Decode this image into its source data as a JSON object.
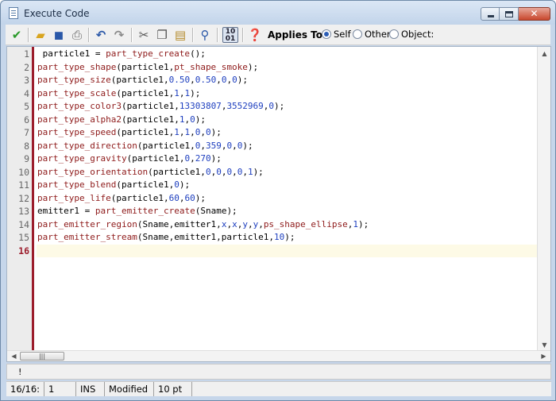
{
  "window": {
    "title": "Execute Code"
  },
  "toolbar": {
    "applies_label": "Applies To:",
    "options": [
      {
        "label": "Self",
        "checked": true
      },
      {
        "label": "Other",
        "checked": false
      },
      {
        "label": "Object:",
        "checked": false
      }
    ],
    "icons": [
      "check-icon",
      "open-folder-icon",
      "save-icon",
      "print-icon",
      "undo-icon",
      "redo-icon",
      "cut-icon",
      "copy-icon",
      "paste-icon",
      "search-icon",
      "toggle-icon",
      "help-icon"
    ]
  },
  "editor": {
    "current_line": 16,
    "lines": [
      [
        [
          "t",
          " particle1 = "
        ],
        [
          "fn",
          "part_type_create"
        ],
        [
          "t",
          "();"
        ]
      ],
      [
        [
          "fn",
          "part_type_shape"
        ],
        [
          "t",
          "(particle1,"
        ],
        [
          "fn",
          "pt_shape_smoke"
        ],
        [
          "t",
          ");"
        ]
      ],
      [
        [
          "fn",
          "part_type_size"
        ],
        [
          "t",
          "(particle1,"
        ],
        [
          "num",
          "0.50"
        ],
        [
          "t",
          ","
        ],
        [
          "num",
          "0.50"
        ],
        [
          "t",
          ","
        ],
        [
          "num",
          "0"
        ],
        [
          "t",
          ","
        ],
        [
          "num",
          "0"
        ],
        [
          "t",
          ");"
        ]
      ],
      [
        [
          "fn",
          "part_type_scale"
        ],
        [
          "t",
          "(particle1,"
        ],
        [
          "num",
          "1"
        ],
        [
          "t",
          ","
        ],
        [
          "num",
          "1"
        ],
        [
          "t",
          ");"
        ]
      ],
      [
        [
          "fn",
          "part_type_color3"
        ],
        [
          "t",
          "(particle1,"
        ],
        [
          "num",
          "13303807"
        ],
        [
          "t",
          ","
        ],
        [
          "num",
          "3552969"
        ],
        [
          "t",
          ","
        ],
        [
          "num",
          "0"
        ],
        [
          "t",
          ");"
        ]
      ],
      [
        [
          "fn",
          "part_type_alpha2"
        ],
        [
          "t",
          "(particle1,"
        ],
        [
          "num",
          "1"
        ],
        [
          "t",
          ","
        ],
        [
          "num",
          "0"
        ],
        [
          "t",
          ");"
        ]
      ],
      [
        [
          "fn",
          "part_type_speed"
        ],
        [
          "t",
          "(particle1,"
        ],
        [
          "num",
          "1"
        ],
        [
          "t",
          ","
        ],
        [
          "num",
          "1"
        ],
        [
          "t",
          ","
        ],
        [
          "num",
          "0"
        ],
        [
          "t",
          ","
        ],
        [
          "num",
          "0"
        ],
        [
          "t",
          ");"
        ]
      ],
      [
        [
          "fn",
          "part_type_direction"
        ],
        [
          "t",
          "(particle1,"
        ],
        [
          "num",
          "0"
        ],
        [
          "t",
          ","
        ],
        [
          "num",
          "359"
        ],
        [
          "t",
          ","
        ],
        [
          "num",
          "0"
        ],
        [
          "t",
          ","
        ],
        [
          "num",
          "0"
        ],
        [
          "t",
          ");"
        ]
      ],
      [
        [
          "fn",
          "part_type_gravity"
        ],
        [
          "t",
          "(particle1,"
        ],
        [
          "num",
          "0"
        ],
        [
          "t",
          ","
        ],
        [
          "num",
          "270"
        ],
        [
          "t",
          ");"
        ]
      ],
      [
        [
          "fn",
          "part_type_orientation"
        ],
        [
          "t",
          "(particle1,"
        ],
        [
          "num",
          "0"
        ],
        [
          "t",
          ","
        ],
        [
          "num",
          "0"
        ],
        [
          "t",
          ","
        ],
        [
          "num",
          "0"
        ],
        [
          "t",
          ","
        ],
        [
          "num",
          "0"
        ],
        [
          "t",
          ","
        ],
        [
          "num",
          "1"
        ],
        [
          "t",
          ");"
        ]
      ],
      [
        [
          "fn",
          "part_type_blend"
        ],
        [
          "t",
          "(particle1,"
        ],
        [
          "num",
          "0"
        ],
        [
          "t",
          ");"
        ]
      ],
      [
        [
          "fn",
          "part_type_life"
        ],
        [
          "t",
          "(particle1,"
        ],
        [
          "num",
          "60"
        ],
        [
          "t",
          ","
        ],
        [
          "num",
          "60"
        ],
        [
          "t",
          ");"
        ]
      ],
      [
        [
          "t",
          "emitter1 = "
        ],
        [
          "fn",
          "part_emitter_create"
        ],
        [
          "t",
          "(Sname);"
        ]
      ],
      [
        [
          "fn",
          "part_emitter_region"
        ],
        [
          "t",
          "(Sname,emitter1,"
        ],
        [
          "res",
          "x"
        ],
        [
          "t",
          ","
        ],
        [
          "res",
          "x"
        ],
        [
          "t",
          ","
        ],
        [
          "res",
          "y"
        ],
        [
          "t",
          ","
        ],
        [
          "res",
          "y"
        ],
        [
          "t",
          ","
        ],
        [
          "fn",
          "ps_shape_ellipse"
        ],
        [
          "t",
          ","
        ],
        [
          "num",
          "1"
        ],
        [
          "t",
          ");"
        ]
      ],
      [
        [
          "fn",
          "part_emitter_stream"
        ],
        [
          "t",
          "(Sname,emitter1,particle1,"
        ],
        [
          "num",
          "10"
        ],
        [
          "t",
          ");"
        ]
      ],
      []
    ]
  },
  "message": "!",
  "status": {
    "position": "16/16:",
    "column": "1",
    "mode": "INS",
    "state": "Modified",
    "font_size": "10 pt"
  }
}
